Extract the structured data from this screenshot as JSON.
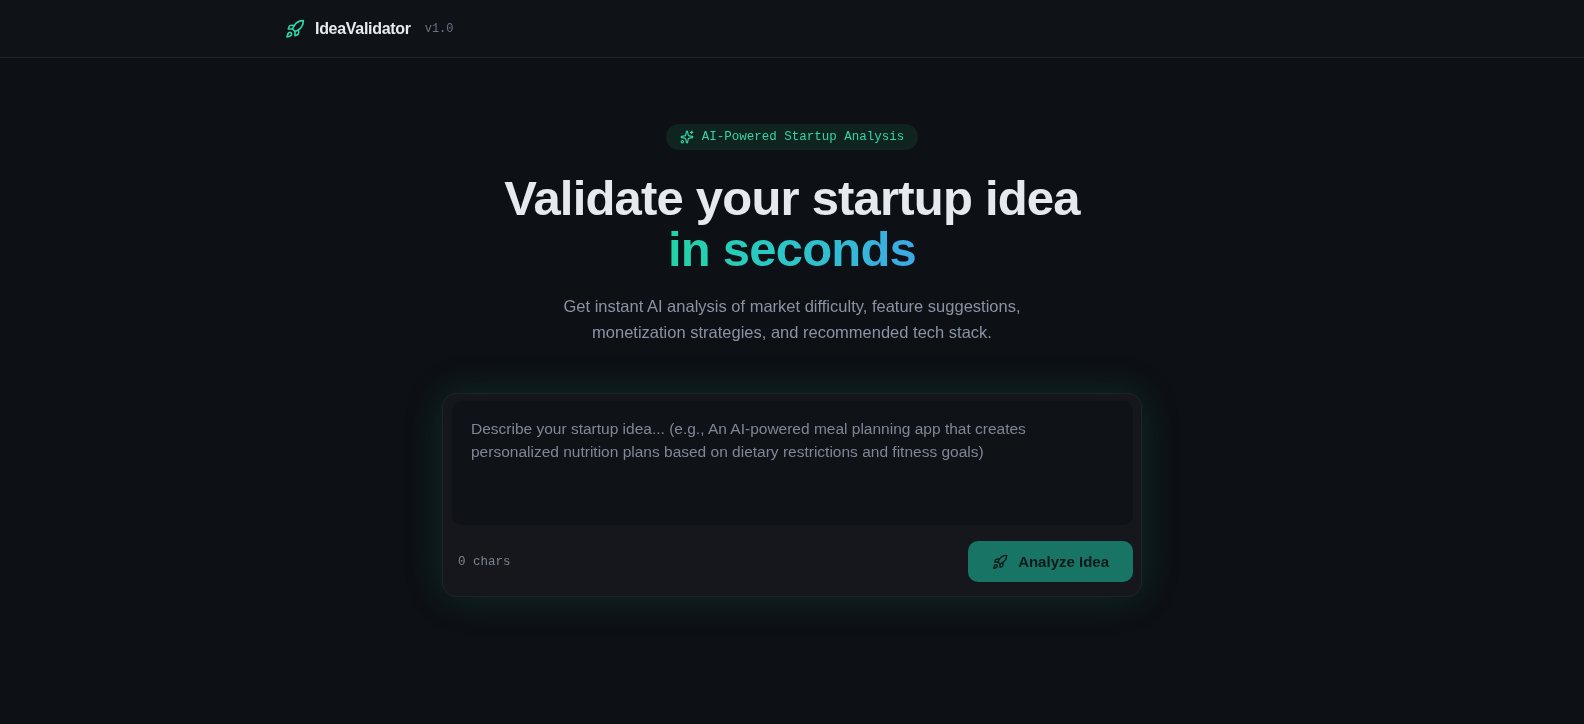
{
  "header": {
    "logo": "IdeaValidator",
    "version": "v1.0"
  },
  "hero": {
    "badge": "AI-Powered Startup Analysis",
    "title": "Validate your startup idea",
    "title_highlight": "in seconds",
    "subtitle": "Get instant AI analysis of market difficulty, feature suggestions, monetization strategies, and recommended tech stack."
  },
  "idea_form": {
    "placeholder": "Describe your startup idea... (e.g., An AI-powered meal planning app that creates personalized nutrition plans based on dietary restrictions and fitness goals)",
    "char_count": "0 chars",
    "submit_button": "Analyze Idea"
  }
}
